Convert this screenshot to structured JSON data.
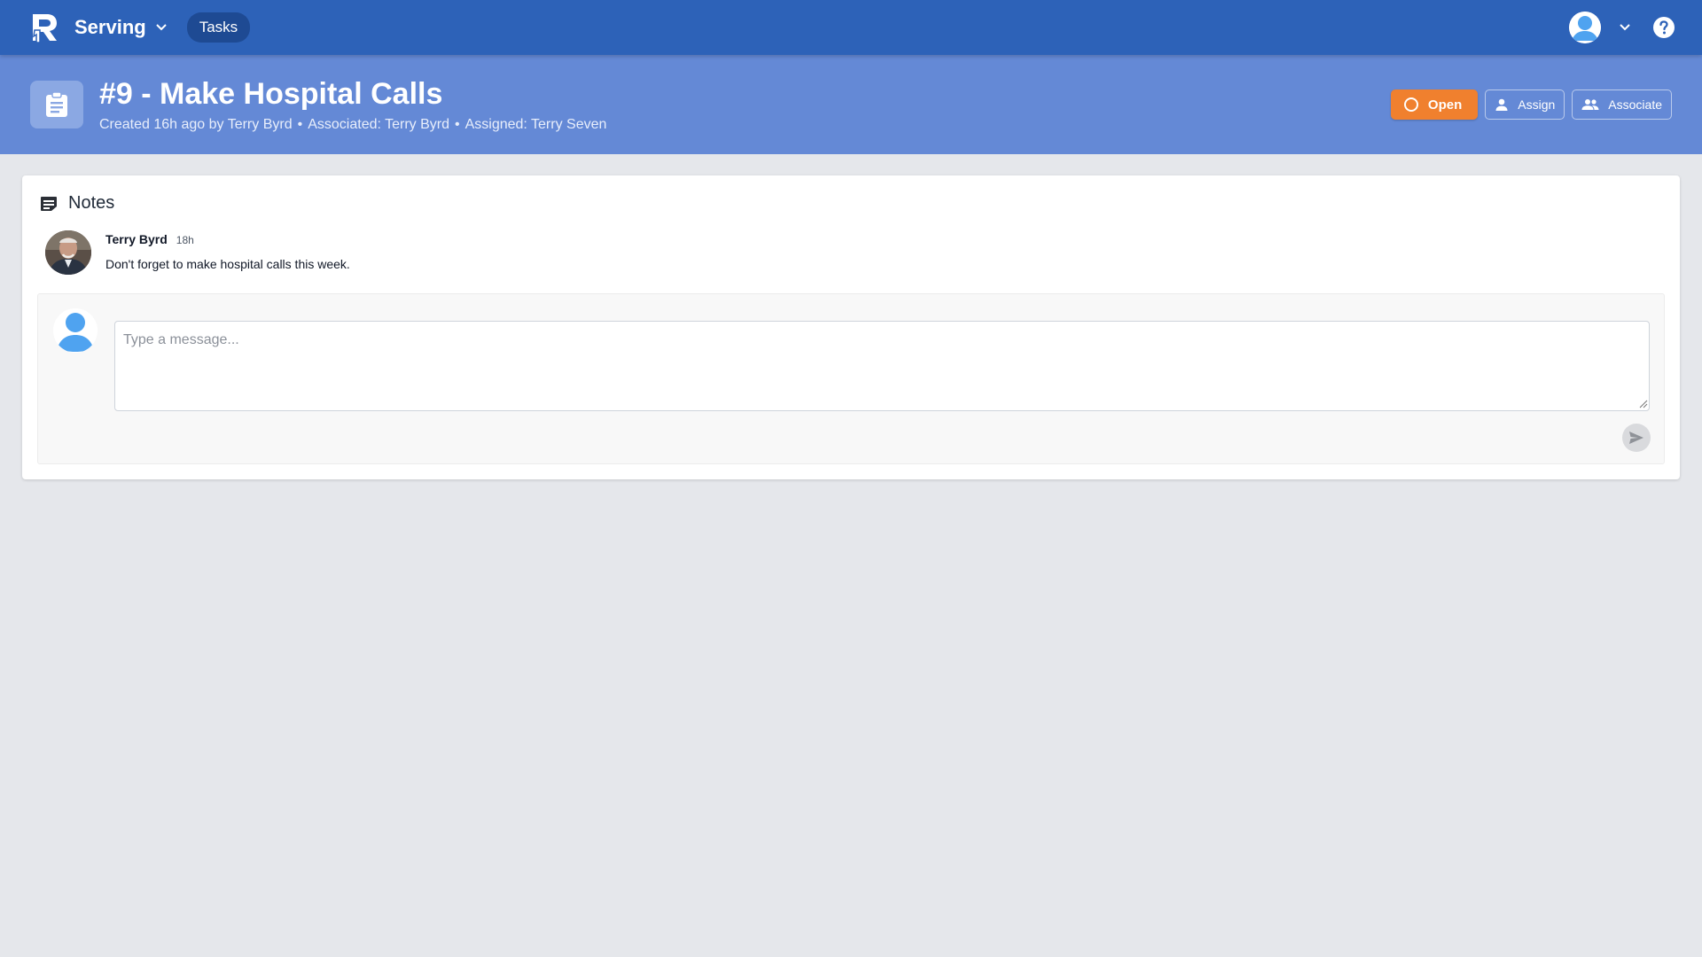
{
  "topbar": {
    "app_name": "Serving",
    "tab_label": "Tasks",
    "brand_color": "#2d62b8"
  },
  "task": {
    "title": "#9 - Make Hospital Calls",
    "meta": {
      "created": "Created 16h ago by Terry Byrd",
      "separator": "•",
      "associated": "Associated: Terry Byrd",
      "assigned": "Assigned: Terry Seven"
    },
    "actions": {
      "status_label": "Open",
      "status_color": "#f0802e",
      "assign_label": "Assign",
      "associate_label": "Associate"
    }
  },
  "notes": {
    "title": "Notes",
    "items": [
      {
        "author": "Terry Byrd",
        "time": "18h",
        "text": "Don't forget to make hospital calls this week."
      }
    ],
    "composer": {
      "placeholder": "Type a message..."
    }
  },
  "icons": {
    "logo": "brand-logo",
    "app_chevron": "chevron-down-icon",
    "user": "user-avatar-icon",
    "help": "help-icon",
    "task": "clipboard-icon",
    "status": "circle-icon",
    "assign": "person-icon",
    "associate": "people-icon",
    "notes": "notes-icon",
    "send": "send-icon"
  }
}
